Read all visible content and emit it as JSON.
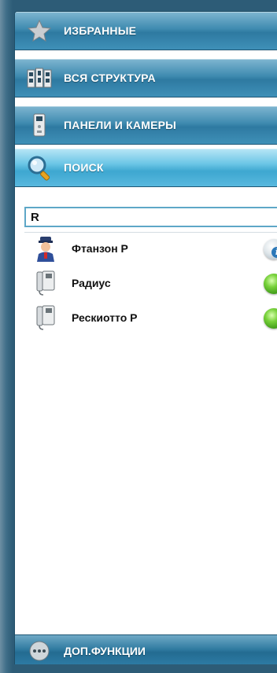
{
  "menu": {
    "favorites_label": "ИЗБРАННЫЕ",
    "structure_label": "ВСЯ СТРУКТУРА",
    "panels_label": "ПАНЕЛИ И КАМЕРЫ",
    "search_label": "ПОИСК"
  },
  "search": {
    "value": "R",
    "placeholder": ""
  },
  "results": [
    {
      "name": "Фтанзон Р",
      "icon": "guard-person-icon",
      "status": "info"
    },
    {
      "name": "Радиус",
      "icon": "intercom-handset-icon",
      "status": "online"
    },
    {
      "name": "Рескиотто Р",
      "icon": "intercom-handset-icon",
      "status": "online"
    }
  ],
  "footer": {
    "extra_label": "ДОП.ФУНКЦИИ"
  },
  "colors": {
    "menu_blue": "#3f8bb0",
    "active_blue": "#58b8de",
    "online_green": "#77d13a",
    "frame": "#2d5c77"
  }
}
